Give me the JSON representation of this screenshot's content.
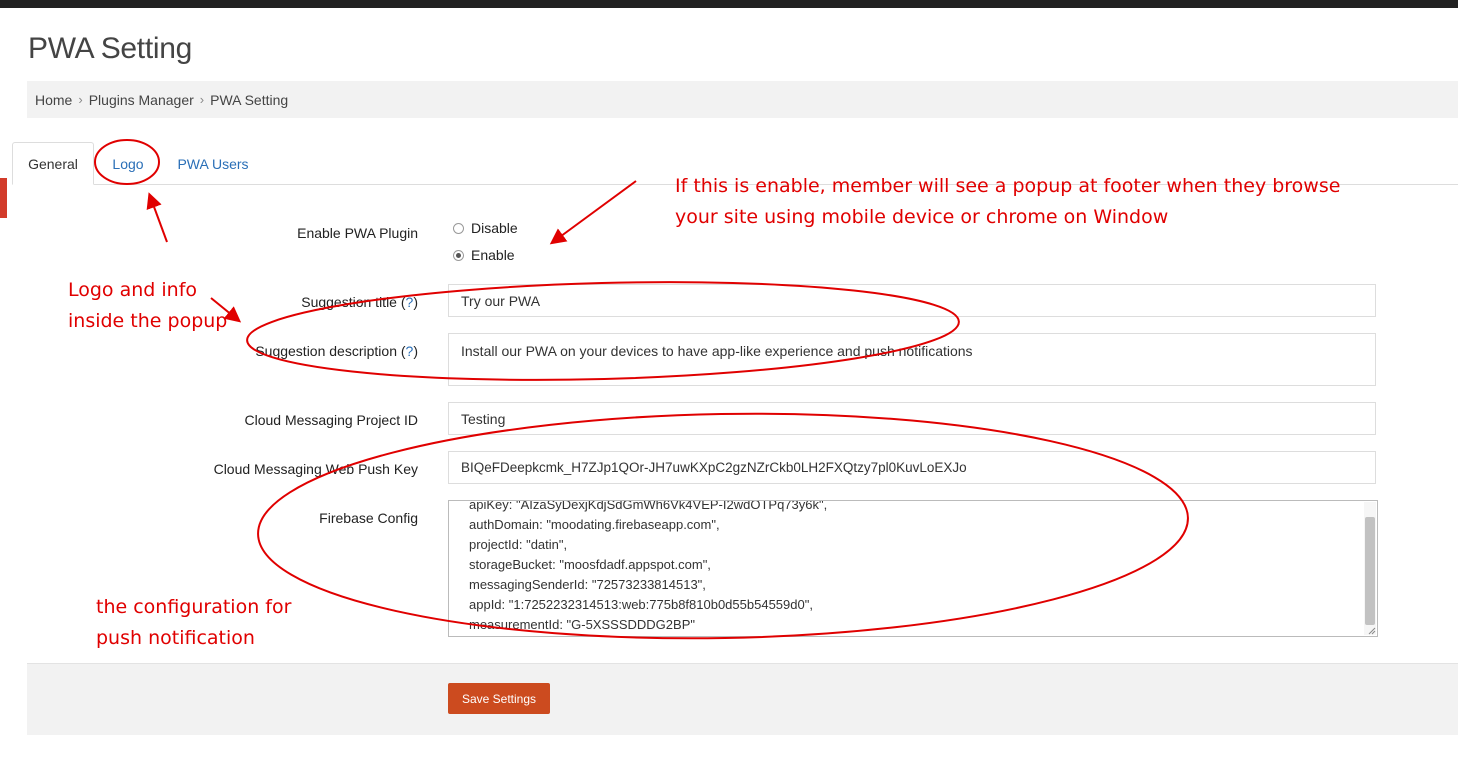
{
  "page": {
    "title": "PWA Setting"
  },
  "breadcrumb": {
    "items": [
      "Home",
      "Plugins Manager",
      "PWA Setting"
    ]
  },
  "tabs": [
    {
      "label": "General",
      "active": true
    },
    {
      "label": "Logo",
      "active": false
    },
    {
      "label": "PWA Users",
      "active": false
    }
  ],
  "form": {
    "enable_plugin": {
      "label": "Enable PWA Plugin",
      "options": [
        "Disable",
        "Enable"
      ],
      "selected": "Enable"
    },
    "suggestion_title": {
      "label": "Suggestion title (",
      "help": "?",
      "label_end": ")",
      "value": "Try our PWA"
    },
    "suggestion_description": {
      "label": "Suggestion description (",
      "help": "?",
      "label_end": ")",
      "value": "Install our PWA on your devices to have app-like experience and push notifications"
    },
    "project_id": {
      "label": "Cloud Messaging Project ID",
      "value": "Testing"
    },
    "web_push_key": {
      "label": "Cloud Messaging Web Push Key",
      "value": "BIQeFDeepkcmk_H7ZJp1QOr-JH7uwKXpC2gzNZrCkb0LH2FXQtzy7pl0KuvLoEXJo"
    },
    "firebase_config": {
      "label": "Firebase Config",
      "lines": [
        "apiKey: \"AIzaSyDexjKdjSdGmWh6Vk4VEP-I2wdOTPq73y6k\",",
        "authDomain: \"moodating.firebaseapp.com\",",
        "projectId: \"datin\",",
        "storageBucket: \"moosfdadf.appspot.com\",",
        "messagingSenderId: \"72573233814513\",",
        "appId: \"1:7252232314513:web:775b8f810b0d55b54559d0\",",
        "measurementId: \"G-5XSSSDDDG2BP\""
      ]
    }
  },
  "actions": {
    "save_label": "Save Settings"
  },
  "annotations": {
    "popup_note": [
      "If this is enable, member will see a popup at footer when they browse",
      "your site using mobile device or chrome on Window"
    ],
    "logo_note": [
      "Logo and info",
      "inside the popup"
    ],
    "config_note": [
      "the configuration for",
      "push notification"
    ]
  },
  "colors": {
    "accent": "#cc4b1f",
    "link": "#2a6fb7",
    "annotation": "#e00000"
  }
}
